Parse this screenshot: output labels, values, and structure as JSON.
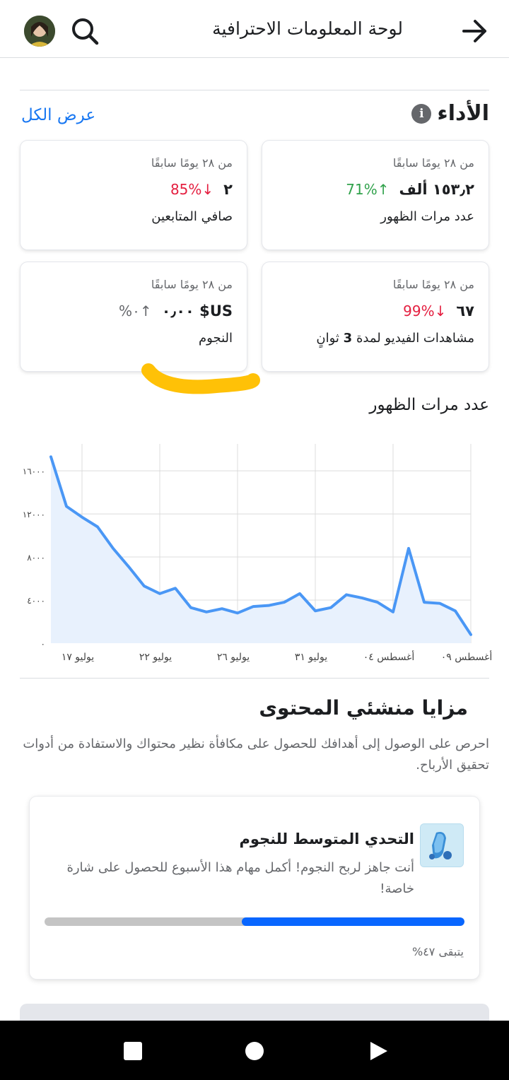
{
  "header": {
    "title": "لوحة المعلومات الاحترافية",
    "back_icon": "arrow-right-icon",
    "search_icon": "search-icon"
  },
  "performance": {
    "title": "الأداء",
    "view_all": "عرض الكل",
    "cards": [
      {
        "since": "من ٢٨ يومًا سابقًا",
        "value": "١٥٣٫٢ ألف",
        "delta": "↑71%",
        "direction": "up",
        "label": "عدد مرات الظهور"
      },
      {
        "since": "من ٢٨ يومًا سابقًا",
        "value": "٢",
        "delta": "↓85%",
        "direction": "down",
        "label": "صافي المتابعين"
      },
      {
        "since": "من ٢٨ يومًا سابقًا",
        "value": "٦٧",
        "delta": "↓99%",
        "direction": "down",
        "label_prefix": "مشاهدات الفيديو لمدة",
        "label_num": "3",
        "label_suffix": "ثوانٍ"
      },
      {
        "since": "من ٢٨ يومًا سابقًا",
        "value": "US$ ٠٫٠٠",
        "delta": "↑٠%",
        "direction": "neutral",
        "label": "النجوم"
      }
    ]
  },
  "chart_title": "عدد مرات الظهور",
  "chart_data": {
    "type": "area",
    "y_ticks": [
      "٠",
      "٤٠٠٠",
      "٨٠٠٠",
      "١٢٠٠٠",
      "١٦٠٠٠"
    ],
    "y_tick_values": [
      0,
      4000,
      8000,
      12000,
      16000
    ],
    "ylim": [
      0,
      18500
    ],
    "x_tick_labels": [
      "يوليو ١٧",
      "يوليو ٢٢",
      "يوليو ٢٦",
      "يوليو ٣١",
      "أغسطس ٠٤",
      "أغسطس ٠٩"
    ],
    "x_tick_index": [
      2,
      7,
      12,
      17,
      22,
      27
    ],
    "values": [
      17300,
      12700,
      11700,
      10800,
      8800,
      7100,
      5300,
      4600,
      5100,
      3300,
      2900,
      3200,
      2800,
      3400,
      3500,
      3800,
      4600,
      3000,
      3300,
      4500,
      4200,
      3800,
      2900,
      8800,
      3800,
      3700,
      3000,
      800
    ],
    "grid": true,
    "line_color": "#4a97f5",
    "fill_color": "#e8f1fd"
  },
  "benefits": {
    "title": "مزايا منشئي المحتوى",
    "description": "احرص على الوصول إلى أهدافك للحصول على مكافأة نظير محتواك والاستفادة من أدوات تحقيق الأرباح.",
    "challenge": {
      "title": "التحدي المتوسط للنجوم",
      "description": "أنت جاهز لربح النجوم! أكمل مهام هذا الأسبوع للحصول على شارة خاصة!",
      "progress": 0.53,
      "remaining": "يتبقى ٤٧%"
    }
  },
  "navbar": {
    "recents_icon": "square-icon",
    "home_icon": "circle-icon",
    "back_icon": "triangle-back-icon"
  }
}
